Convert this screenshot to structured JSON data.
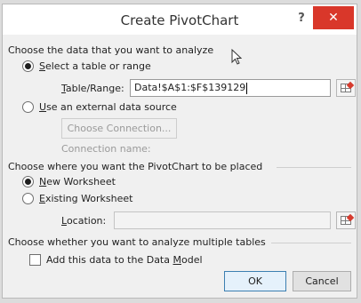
{
  "dialog": {
    "title": "Create PivotChart",
    "help_label": "?",
    "close_label": "✕"
  },
  "section1": {
    "heading": "Choose the data that you want to analyze",
    "option_table": {
      "label_accel": "S",
      "label_rest": "elect a table or range",
      "checked": true
    },
    "table_range": {
      "label_accel": "T",
      "label_rest": "able/Range:",
      "value": "Data!$A$1:$F$139129"
    },
    "option_external": {
      "label_accel": "U",
      "label_rest": "se an external data source",
      "checked": false
    },
    "choose_connection_label": "Choose Connection...",
    "connection_name_label": "Connection name:"
  },
  "section2": {
    "heading": "Choose where you want the PivotChart to be placed",
    "option_new": {
      "label_accel": "N",
      "label_rest": "ew Worksheet",
      "checked": true
    },
    "option_existing": {
      "label_accel": "E",
      "label_rest": "xisting Worksheet",
      "checked": false
    },
    "location": {
      "label_accel": "L",
      "label_rest": "ocation:",
      "value": ""
    }
  },
  "section3": {
    "heading": "Choose whether you want to analyze multiple tables",
    "data_model": {
      "label_pre": "Add this data to the Data ",
      "label_accel": "M",
      "label_post": "odel",
      "checked": false
    }
  },
  "buttons": {
    "ok": "OK",
    "cancel": "Cancel"
  }
}
